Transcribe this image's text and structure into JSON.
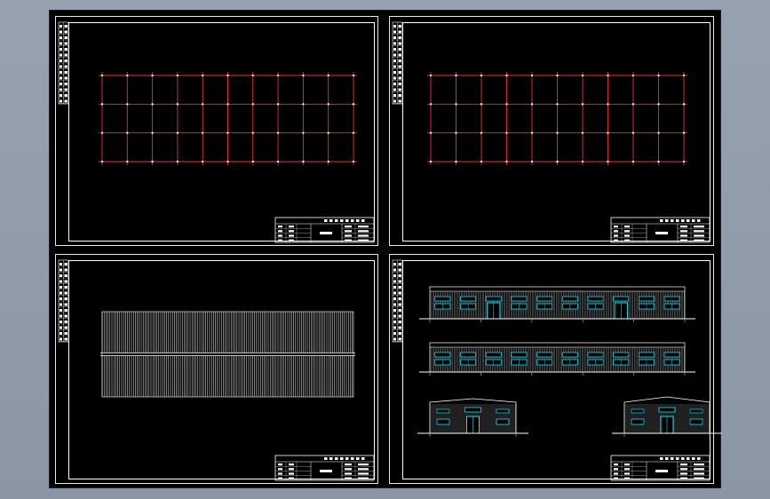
{
  "colors": {
    "background": "#8f9aa8",
    "canvas": "#000000",
    "grid_line": "#ff2a2a",
    "grid_node": "#ffffff",
    "drawing_line": "#ffffff",
    "window": "#00e5ff",
    "ground": "#33cc33"
  },
  "sheets": [
    {
      "id": "sheet-top-left",
      "view": "foundation-grid-plan",
      "grid_cols": 10,
      "grid_rows": 3
    },
    {
      "id": "sheet-top-right",
      "view": "column-grid-plan",
      "grid_cols": 10,
      "grid_rows": 3
    },
    {
      "id": "sheet-bottom-left",
      "view": "roof-panel-plan",
      "panel_rows": 2
    },
    {
      "id": "sheet-bottom-right",
      "view": "elevations",
      "long_elevation_bays": 10,
      "gable_elevations": 2
    }
  ]
}
